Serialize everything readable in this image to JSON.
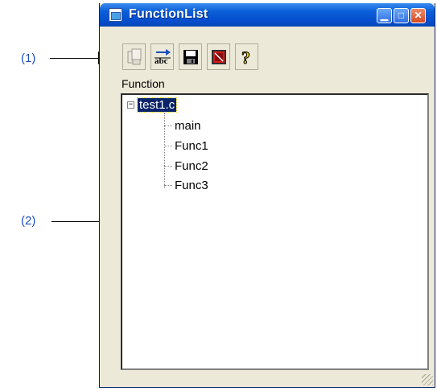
{
  "window": {
    "title": "FunctionList",
    "icon": "function-list-app-icon",
    "controls": [
      "minimize-icon",
      "maximize-icon",
      "close-icon"
    ]
  },
  "callouts": [
    {
      "label": "(1)"
    },
    {
      "label": "(2)"
    }
  ],
  "toolbar": {
    "buttons": [
      {
        "name": "copy-button",
        "icon": "copy-icon"
      },
      {
        "name": "sort-button",
        "icon": "sort-abc-icon"
      },
      {
        "name": "save-button",
        "icon": "save-icon"
      },
      {
        "name": "setting-button",
        "icon": "setting-icon"
      },
      {
        "name": "help-button",
        "icon": "help-icon"
      }
    ]
  },
  "panel": {
    "label": "Function",
    "tree": {
      "root": {
        "label": "test1.c",
        "expanded": true,
        "selected": true
      },
      "children": [
        "main",
        "Func1",
        "Func2",
        "Func3"
      ]
    }
  }
}
